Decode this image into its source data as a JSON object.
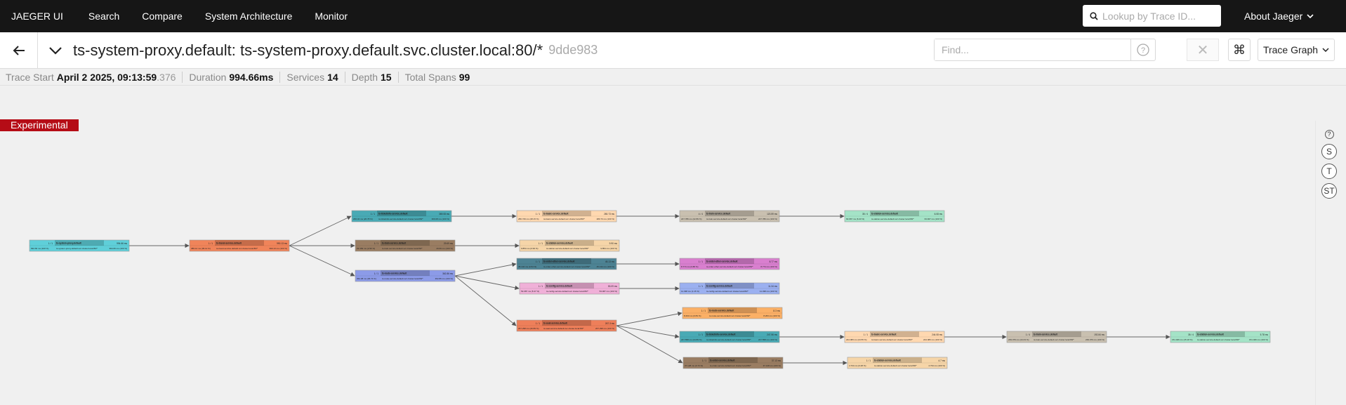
{
  "nav": {
    "brand": "JAEGER UI",
    "items": [
      "Search",
      "Compare",
      "System Architecture",
      "Monitor"
    ],
    "lookup_placeholder": "Lookup by Trace ID...",
    "about": "About Jaeger"
  },
  "trace": {
    "title": "ts-system-proxy.default: ts-system-proxy.default.svc.cluster.local:80/*",
    "id": "9dde983",
    "find_placeholder": "Find...",
    "view_mode": "Trace Graph"
  },
  "meta": {
    "start_label": "Trace Start",
    "start_value": "April 2 2025, 09:13:59",
    "start_ms": ".376",
    "duration_label": "Duration",
    "duration_value": "994.66ms",
    "services_label": "Services",
    "services_value": "14",
    "depth_label": "Depth",
    "depth_value": "15",
    "spans_label": "Total Spans",
    "spans_value": "99"
  },
  "experimental": "Experimental",
  "tools": {
    "help": "?",
    "s": "S",
    "t": "T",
    "st": "ST"
  },
  "graph": {
    "nodes": [
      {
        "id": "n1",
        "count": "1 / 1",
        "service": "ts-system-proxy.default",
        "op": "ts-system-proxy.default.svc.cluster.local:80/*",
        "time": "994.66 ms",
        "pct": "994.66 ms (100 %)",
        "self": "994.66 ms (100 %)",
        "color": "#5fcfd9"
      },
      {
        "id": "n2",
        "count": "1 / 1",
        "service": "ts-travel-service.default",
        "op": "ts-travel-service.default.svc.cluster.local:80/*",
        "time": "990.13 ms",
        "pct": "389.12 ms (39.12 %)",
        "self": "990.13 ms (100 %)",
        "color": "#f0845a"
      },
      {
        "id": "n3",
        "count": "1 / 1",
        "service": "ts-ticketinfo-service.default",
        "op": "ts-ticketinfo-service.default.svc.cluster.local:80/*",
        "time": "369.08 ms",
        "pct": "266.34 ms (26.78 %)",
        "self": "369.08 ms (100 %)",
        "color": "#49aab5"
      },
      {
        "id": "n4",
        "count": "1 / 1",
        "service": "ts-train-service.default",
        "op": "ts-train-service.default.svc.cluster.local:80/*",
        "time": "29.69 ms",
        "pct": "29.469 ms (2.96 %)",
        "self": "29.69 ms (100 %)",
        "color": "#9a7d62"
      },
      {
        "id": "n5",
        "count": "1 / 1",
        "service": "ts-route-service.default",
        "op": "ts-route-service.default.svc.cluster.local:80/*",
        "time": "362.86 ms",
        "pct": "364.38 ms (36.74 %)",
        "self": "362.86 ms (100 %)",
        "color": "#8c9be8"
      },
      {
        "id": "n6",
        "count": "1 / 1",
        "service": "ts-basic-service.default",
        "op": "ts-basic-service.default.svc.cluster.local:80/*",
        "time": "280.73 ms",
        "pct": "280.729 ms (28.15 %)",
        "self": "280.73 ms (100 %)",
        "color": "#ffd8b0"
      },
      {
        "id": "n7",
        "count": "1 / 1",
        "service": "ts-station-service.default",
        "op": "ts-station-service.default.svc.cluster.local:80/*",
        "time": "9.90 ms",
        "pct": "9.854 ms (0.99 %)",
        "self": "9.854 ms (100 %)",
        "color": "#f6d5a8"
      },
      {
        "id": "n8",
        "count": "1 / 1",
        "service": "ts-order-other-service.default",
        "op": "ts-order-other-service.default.svc.cluster.local:80/*",
        "time": "45.13 ms",
        "pct": "45.134 ms (4.54 %)",
        "self": "45.134 ms (100 %)",
        "color": "#4d8394"
      },
      {
        "id": "n9",
        "count": "1 / 1",
        "service": "ts-config-service.default",
        "op": "ts-config-service.default.svc.cluster.local:80/*",
        "time": "53.09 ms",
        "pct": "53.087 ms (5.37 %)",
        "self": "53.087 ms (100 %)",
        "color": "#f0b0d8"
      },
      {
        "id": "n10",
        "count": "1 / 1",
        "service": "ts-seat-service.default",
        "op": "ts-seat-service.default.svc.cluster.local:80/*",
        "time": "267.3 ms",
        "pct": "267.298 ms (26.89 %)",
        "self": "267.298 ms (100 %)",
        "color": "#ee7f5a"
      },
      {
        "id": "n11",
        "count": "4 / 4",
        "service": "ts-train-service.default",
        "op": "ts-train-service.default.svc.cluster.local:80/*",
        "time": "120.59 ms",
        "pct": "247.786 ms (22.89 %)",
        "self": "247.786 ms (100 %)",
        "color": "#c9c0b0"
      },
      {
        "id": "n12",
        "count": "1 / 1",
        "service": "ts-order-other-service.default",
        "op": "ts-order-other-service.default.svc.cluster.local:80/*",
        "time": "8.77 ms",
        "pct": "8.774 ms (0.88 %)",
        "self": "8.774 ms (100 %)",
        "color": "#d97fcf"
      },
      {
        "id": "n13",
        "count": "1 / 1",
        "service": "ts-config-service.default",
        "op": "ts-config-service.default.svc.cluster.local:80/*",
        "time": "11.34 ms",
        "pct": "11.338 ms (1.15 %)",
        "self": "11.338 ms (100 %)",
        "color": "#9bb0f0"
      },
      {
        "id": "n14",
        "count": "1 / 1",
        "service": "ts-route-service.default",
        "op": "ts-route-service.default.svc.cluster.local:80/*",
        "time": "8.3 ms",
        "pct": "8.263 ms (0.83 %)",
        "self": "8.263 ms (100 %)",
        "color": "#fbb066"
      },
      {
        "id": "n15",
        "count": "1 / 1",
        "service": "ts-ticketinfo-service.default",
        "op": "ts-ticketinfo-service.default.svc.cluster.local:80/*",
        "time": "247.56 ms",
        "pct": "247.558 ms (24.89 %)",
        "self": "247.558 ms (100 %)",
        "color": "#49aab5"
      },
      {
        "id": "n16",
        "count": "1 / 1",
        "service": "ts-order-service.default",
        "op": "ts-order-service.default.svc.cluster.local:80/*",
        "time": "37.13 ms",
        "pct": "37.128 ms (3.73 %)",
        "self": "37.128 ms (100 %)",
        "color": "#9a7d62"
      },
      {
        "id": "n17",
        "count": "35 / 4",
        "service": "ts-station-service.default",
        "op": "ts-station-service.default.svc.cluster.local:80/*",
        "time": "6.08 ms",
        "pct": "63.967 ms (6.43 %)",
        "self": "63.967 ms (100 %)",
        "color": "#a4e3c7"
      },
      {
        "id": "n18",
        "count": "1 / 1",
        "service": "ts-basic-service.default",
        "op": "ts-basic-service.default.svc.cluster.local:80/*",
        "time": "244.08 ms",
        "pct": "244.083 ms (24.55 %)",
        "self": "244.083 ms (100 %)",
        "color": "#ffd8b0"
      },
      {
        "id": "n19",
        "count": "1 / 1",
        "service": "ts-station-service.default",
        "op": "ts-station-service.default.svc.cluster.local:80/*",
        "time": "4.7 ms",
        "pct": "4.734 ms (0.48 %)",
        "self": "4.734 ms (100 %)",
        "color": "#f6d5a8"
      },
      {
        "id": "n20",
        "count": "1 / 4",
        "service": "ts-train-service.default",
        "op": "ts-train-service.default.svc.cluster.local:80/*",
        "time": "192.84 ms",
        "pct": "239.079 ms (24.03 %)",
        "self": "239.079 ms (100 %)",
        "color": "#c9c0b0"
      },
      {
        "id": "n21",
        "count": "35 / 4",
        "service": "ts-station-service.default",
        "op": "ts-station-service.default.svc.cluster.local:80/*",
        "time": "5.78 ms",
        "pct": "151.026 ms (15.18 %)",
        "self": "151.026 ms (100 %)",
        "color": "#a4e3c7"
      }
    ]
  }
}
